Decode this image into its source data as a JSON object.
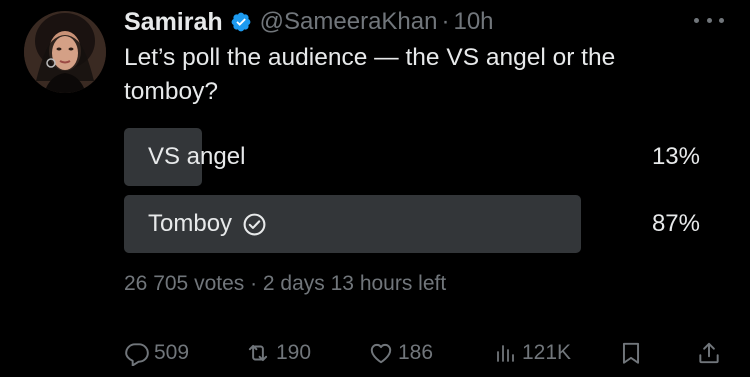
{
  "tweet": {
    "display_name": "Samirah",
    "handle": "@SameeraKhan",
    "separator": "·",
    "time": "10h",
    "text": "Let’s poll the audience — the VS angel or the tomboy?"
  },
  "poll": {
    "options": [
      {
        "label": "VS angel",
        "percent": "13%",
        "fraction": 0.13,
        "winner": false
      },
      {
        "label": "Tomboy",
        "percent": "87%",
        "fraction": 0.87,
        "winner": true
      }
    ],
    "meta": "26 705 votes · 2 days 13 hours left"
  },
  "actions": {
    "replies": "509",
    "reposts": "190",
    "likes": "186",
    "views": "121K"
  },
  "colors": {
    "background": "#000000",
    "text": "#e7e9ea",
    "muted": "#71767b",
    "poll_fill": "#333639",
    "verified": "#1d9bf0"
  },
  "icons": {
    "verified": "verified-badge-icon",
    "more": "more-dots-icon",
    "winner": "check-circle-icon",
    "reply": "reply-icon",
    "repost": "repost-icon",
    "like": "heart-icon",
    "views": "views-icon",
    "bookmark": "bookmark-icon",
    "share": "share-icon"
  }
}
